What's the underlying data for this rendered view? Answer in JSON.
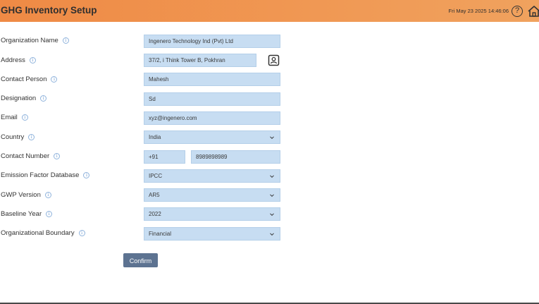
{
  "header": {
    "title": "GHG Inventory Setup",
    "datetime": "Fri May 23 2025 14:46:06",
    "help_label": "?",
    "accent_start": "#ef8a45",
    "accent_end": "#f0a25e"
  },
  "form": {
    "organization_name": {
      "label": "Organization Name",
      "value": "Ingenero Technology Ind (Pvt) Ltd"
    },
    "address": {
      "label": "Address",
      "value": "37/2, i Think Tower B, Pokhran"
    },
    "contact_person": {
      "label": "Contact Person",
      "value": "Mahesh"
    },
    "designation": {
      "label": "Designation",
      "value": "Sd"
    },
    "email": {
      "label": "Email",
      "value": "xyz@ingenero.com"
    },
    "country": {
      "label": "Country",
      "value": "India"
    },
    "contact_number": {
      "label": "Contact Number",
      "code": "+91",
      "value": "8989898989"
    },
    "emission_factor_database": {
      "label": "Emission Factor Database",
      "value": "IPCC"
    },
    "gwp_version": {
      "label": "GWP Version",
      "value": "AR5"
    },
    "baseline_year": {
      "label": "Baseline Year",
      "value": "2022"
    },
    "organizational_boundary": {
      "label": "Organizational Boundary",
      "value": "Financial"
    },
    "info_glyph": "i",
    "field_color": "#c7ddf2"
  },
  "actions": {
    "confirm_label": "Confirm",
    "confirm_color": "#5d7391"
  }
}
